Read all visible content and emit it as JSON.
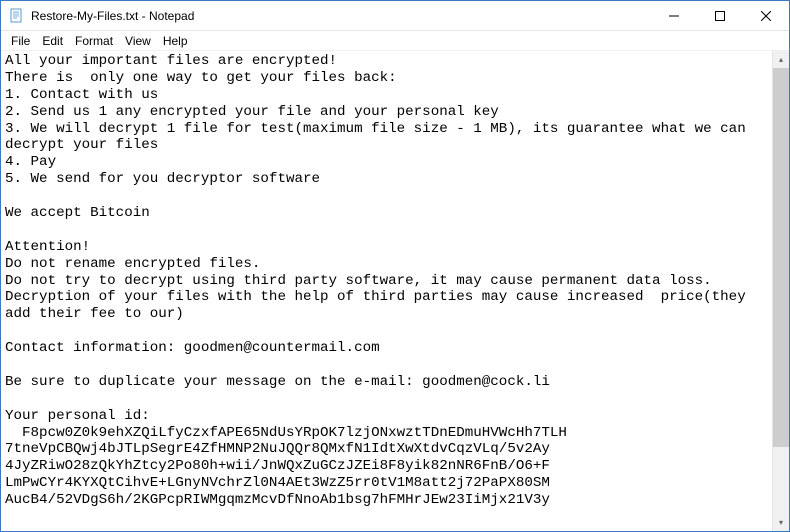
{
  "window": {
    "title": "Restore-My-Files.txt - Notepad"
  },
  "menubar": {
    "items": [
      "File",
      "Edit",
      "Format",
      "View",
      "Help"
    ]
  },
  "editor": {
    "text": "All your important files are encrypted!\nThere is  only one way to get your files back:\n1. Contact with us\n2. Send us 1 any encrypted your file and your personal key\n3. We will decrypt 1 file for test(maximum file size - 1 MB), its guarantee what we can decrypt your files\n4. Pay\n5. We send for you decryptor software\n\nWe accept Bitcoin\n\nAttention!\nDo not rename encrypted files.\nDo not try to decrypt using third party software, it may cause permanent data loss.\nDecryption of your files with the help of third parties may cause increased  price(they add their fee to our)\n\nContact information: goodmen@countermail.com\n\nBe sure to duplicate your message on the e-mail: goodmen@cock.li\n\nYour personal id:\n  F8pcw0Z0k9ehXZQiLfyCzxfAPE65NdUsYRpOK7lzjONxwztTDnEDmuHVWcHh7TLH\n7tneVpCBQwj4bJTLpSegrE4ZfHMNP2NuJQQr8QMxfN1IdtXwXtdvCqzVLq/5v2Ay\n4JyZRiwO28zQkYhZtcy2Po80h+wii/JnWQxZuGCzJZEi8F8yik82nNR6FnB/O6+F\nLmPwCYr4KYXQtCihvE+LGnyNVchrZl0N4AEt3WzZ5rr0tV1M8att2j72PaPX80SM\nAucB4/52VDgS6h/2KGPcpRIWMgqmzMcvDfNnoAb1bsg7hFMHrJEw23IiMjx21V3y"
  }
}
